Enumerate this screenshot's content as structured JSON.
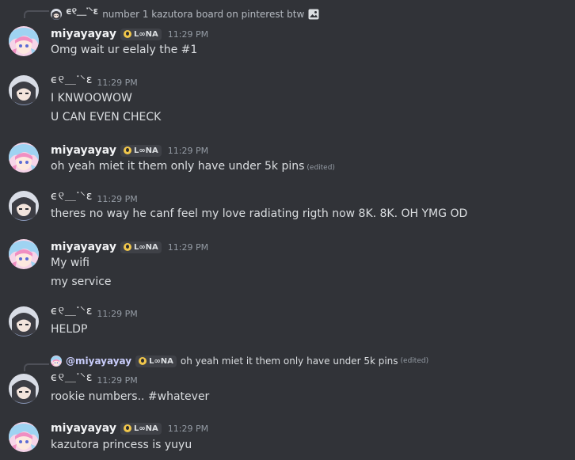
{
  "colors": {
    "background": "#313338",
    "author": "#f2f3f5",
    "timestamp": "#949ba4",
    "text": "#dbdee1",
    "tag_icon": "#f0c64b"
  },
  "reply1": {
    "author": "ϵ୧⸏་⸌ε",
    "text": "number 1 kazutora board on pinterest btw",
    "icon": "image-icon"
  },
  "msg1": {
    "author": "miyayayay",
    "tag": "L∞NA",
    "time": "11:29 PM",
    "lines": [
      "Omg wait ur eelaly the #1"
    ]
  },
  "msg2": {
    "author": "ϵ୧⸏་⸌ε",
    "time": "11:29 PM",
    "lines": [
      "I KNWOOWOW",
      "U CAN EVEN CHECK"
    ]
  },
  "msg3": {
    "author": "miyayayay",
    "tag": "L∞NA",
    "time": "11:29 PM",
    "lines": [
      "oh yeah miet it them only have under 5k pins"
    ],
    "edited": "(edited)"
  },
  "msg4": {
    "author": "ϵ୧⸏་⸌ε",
    "time": "11:29 PM",
    "lines": [
      "theres no way he canf feel my love radiating rigth now 8K. 8K. OH YMG OD"
    ]
  },
  "msg5": {
    "author": "miyayayay",
    "tag": "L∞NA",
    "time": "11:29 PM",
    "lines": [
      "My wifi",
      "my service"
    ]
  },
  "msg6": {
    "author": "ϵ୧⸏་⸌ε",
    "time": "11:29 PM",
    "lines": [
      "HELDP"
    ]
  },
  "reply2": {
    "author": "@miyayayay",
    "tag": "L∞NA",
    "text": "oh yeah miet it them only have under 5k pins",
    "edited": "(edited)"
  },
  "msg7": {
    "author": "ϵ୧⸏་⸌ε",
    "time": "11:29 PM",
    "lines": [
      "rookie numbers.. #whatever"
    ]
  },
  "msg8": {
    "author": "miyayayay",
    "tag": "L∞NA",
    "time": "11:29 PM",
    "lines": [
      "kazutora princess is yuyu"
    ]
  }
}
